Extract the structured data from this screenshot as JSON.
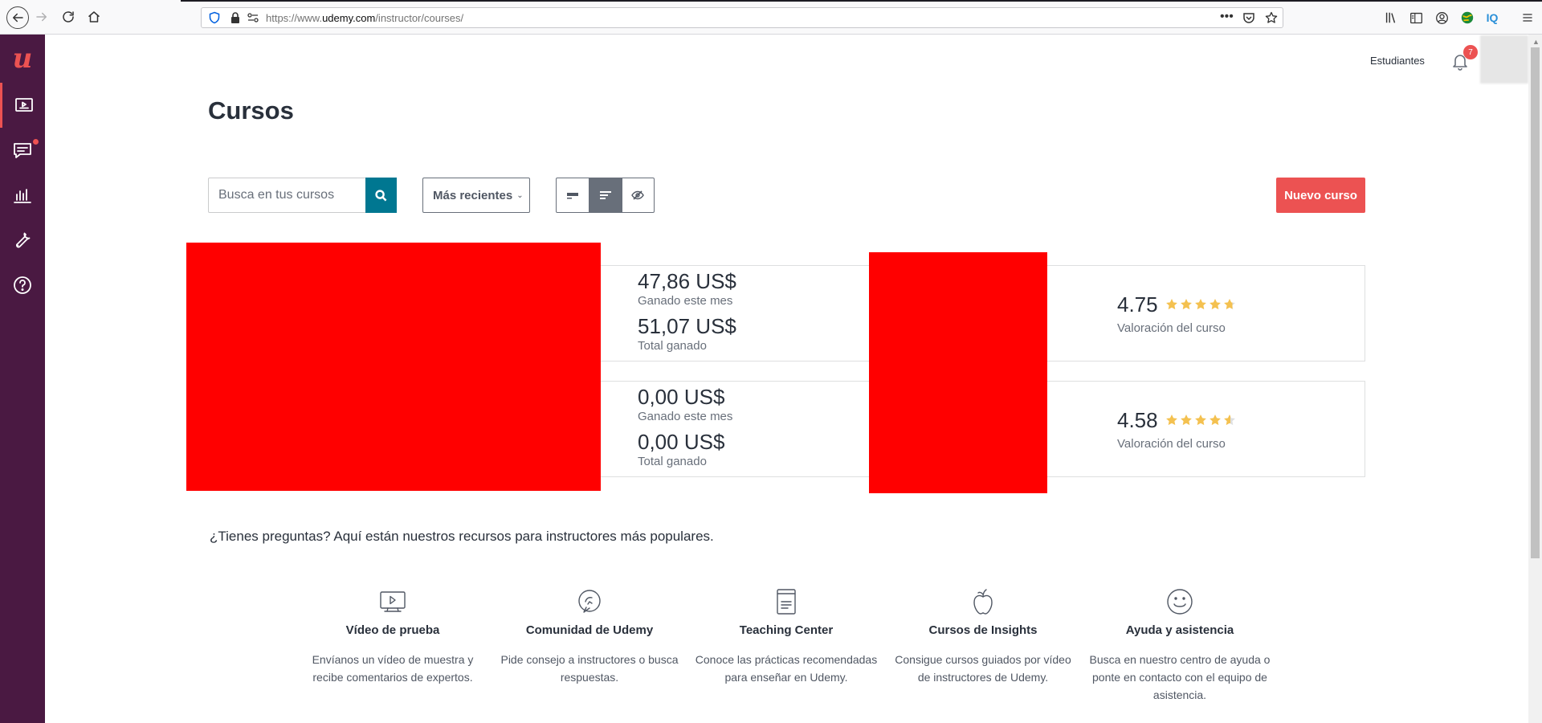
{
  "browser": {
    "url_prefix": "https://www.",
    "url_domain": "udemy.com",
    "url_path": "/instructor/courses/",
    "ext_label": "IQ"
  },
  "header": {
    "students_link": "Estudiantes",
    "notification_count": "7"
  },
  "sidebar": {
    "logo": "u"
  },
  "page": {
    "title": "Cursos"
  },
  "toolbar": {
    "search_placeholder": "Busca en tus cursos",
    "sort_label": "Más recientes",
    "new_course_label": "Nuevo curso"
  },
  "courses": [
    {
      "earned_this_month": "47,86 US$",
      "earned_this_month_label": "Ganado este mes",
      "total_earned": "51,07 US$",
      "total_earned_label": "Total ganado",
      "rating": "4.75",
      "rating_value": 4.75,
      "rating_label": "Valoración del curso"
    },
    {
      "earned_this_month": "0,00 US$",
      "earned_this_month_label": "Ganado este mes",
      "total_earned": "0,00 US$",
      "total_earned_label": "Total ganado",
      "rating": "4.58",
      "rating_value": 4.58,
      "rating_label": "Valoración del curso"
    }
  ],
  "resources": {
    "title": "¿Tienes preguntas? Aquí están nuestros recursos para instructores más populares.",
    "items": [
      {
        "icon": "video-icon",
        "title": "Vídeo de prueba",
        "desc": "Envíanos un vídeo de muestra y recibe comentarios de expertos."
      },
      {
        "icon": "community-icon",
        "title": "Comunidad de Udemy",
        "desc": "Pide consejo a instructores o busca respuestas."
      },
      {
        "icon": "book-icon",
        "title": "Teaching Center",
        "desc": "Conoce las prácticas recomendadas para enseñar en Udemy."
      },
      {
        "icon": "apple-icon",
        "title": "Cursos de Insights",
        "desc": "Consigue cursos guiados por vídeo de instructores de Udemy."
      },
      {
        "icon": "smile-icon",
        "title": "Ayuda y asistencia",
        "desc": "Busca en nuestro centro de ayuda o ponte en contacto con el equipo de asistencia."
      }
    ]
  },
  "colors": {
    "brand_red": "#ec5252",
    "sidebar_purple": "#4a1942",
    "search_teal": "#007791",
    "star_gold": "#f4c150"
  }
}
